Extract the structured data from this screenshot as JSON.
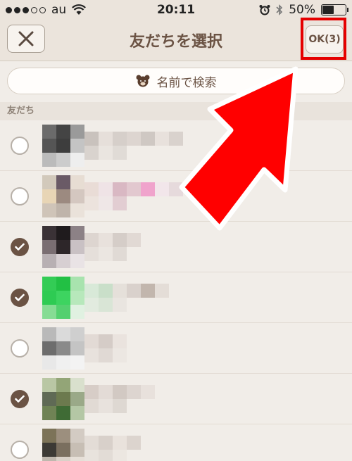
{
  "status_bar": {
    "carrier": "au",
    "time": "20:11",
    "battery_text": "50%",
    "battery_level": 0.5,
    "signal_bars_filled": 3,
    "signal_bars_total": 5
  },
  "nav": {
    "title": "友だちを選択",
    "ok_label": "OK(3)"
  },
  "search": {
    "label": "名前で検索"
  },
  "section": {
    "label": "友だち"
  },
  "friends": [
    {
      "checked": false
    },
    {
      "checked": false
    },
    {
      "checked": true
    },
    {
      "checked": true
    },
    {
      "checked": false
    },
    {
      "checked": true
    },
    {
      "checked": false
    }
  ],
  "colors": {
    "accent": "#6b5344",
    "highlight": "#e50000",
    "background": "#f1ede8"
  }
}
